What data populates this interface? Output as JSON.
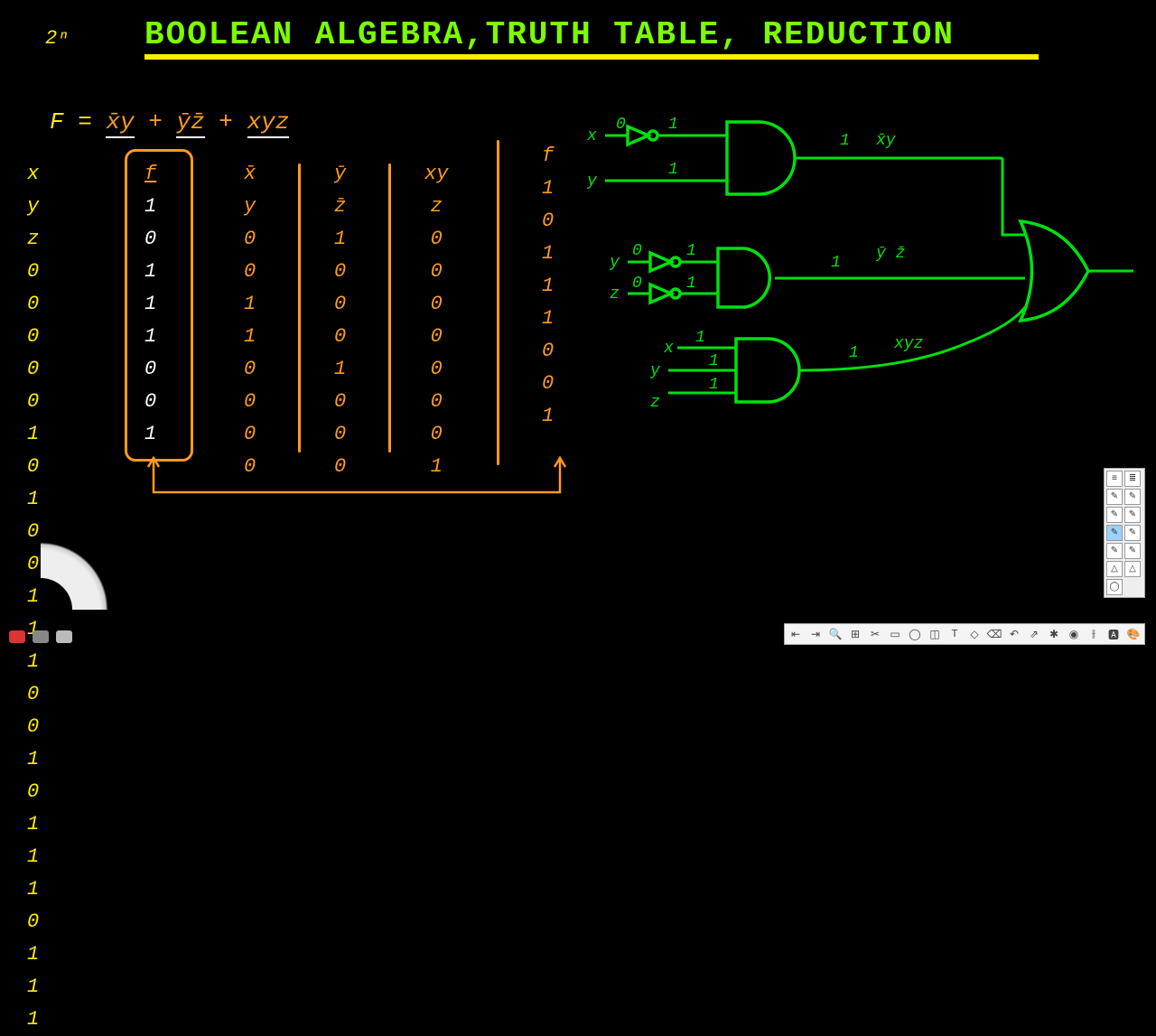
{
  "corner_label": "2ⁿ",
  "title": "BOOLEAN ALGEBRA,TRUTH TABLE, REDUCTION",
  "formula": {
    "lhs": "F =",
    "term1": "x̄y",
    "plus1": "+",
    "term2": "ȳz̄",
    "plus2": "+",
    "term3": "xyz"
  },
  "truth_table": {
    "headers": {
      "xyz": "x y z",
      "f": "f",
      "xbary": "x̄ y",
      "ybarzbar": "ȳ z̄",
      "xyz_term": "xy z",
      "f2": "f"
    },
    "rows": [
      {
        "x": "0",
        "y": "0",
        "z": "0",
        "f": "1",
        "xbary": "0",
        "ybarzbar": "1",
        "xyz": "0",
        "f2": "1"
      },
      {
        "x": "0",
        "y": "0",
        "z": "1",
        "f": "0",
        "xbary": "0",
        "ybarzbar": "0",
        "xyz": "0",
        "f2": "0"
      },
      {
        "x": "0",
        "y": "1",
        "z": "0",
        "f": "1",
        "xbary": "1",
        "ybarzbar": "0",
        "xyz": "0",
        "f2": "1"
      },
      {
        "x": "0",
        "y": "1",
        "z": "1",
        "f": "1",
        "xbary": "1",
        "ybarzbar": "0",
        "xyz": "0",
        "f2": "1"
      },
      {
        "x": "1",
        "y": "0",
        "z": "0",
        "f": "1",
        "xbary": "0",
        "ybarzbar": "1",
        "xyz": "0",
        "f2": "1"
      },
      {
        "x": "1",
        "y": "0",
        "z": "1",
        "f": "0",
        "xbary": "0",
        "ybarzbar": "0",
        "xyz": "0",
        "f2": "0"
      },
      {
        "x": "1",
        "y": "1",
        "z": "0",
        "f": "0",
        "xbary": "0",
        "ybarzbar": "0",
        "xyz": "0",
        "f2": "0"
      },
      {
        "x": "1",
        "y": "1",
        "z": "1",
        "f": "1",
        "xbary": "0",
        "ybarzbar": "0",
        "xyz": "1",
        "f2": "1"
      }
    ]
  },
  "circuit": {
    "inputs1": {
      "a": "x",
      "b": "y"
    },
    "out1": "x̄y",
    "inputs2": {
      "a": "y",
      "b": "z"
    },
    "out2": "ȳ z̄",
    "inputs3": {
      "a": "x",
      "b": "y",
      "c": "z"
    },
    "out3": "xyz",
    "bits": {
      "zero": "0",
      "one": "1"
    }
  },
  "toolbar_bottom": [
    "⇤",
    "⇥",
    "🔍",
    "⊞",
    "✂",
    "▭",
    "◯",
    "◫",
    "T",
    "◇",
    "⌫",
    "↶",
    "⇗",
    "✱",
    "◉",
    "⫲",
    "🅰",
    "🎨"
  ],
  "toolbar_side": [
    "≡",
    "≣",
    "✎",
    "✎",
    "✎",
    "✎",
    "✎",
    "✎",
    "✎",
    "✎",
    "△",
    "△",
    "◯"
  ]
}
